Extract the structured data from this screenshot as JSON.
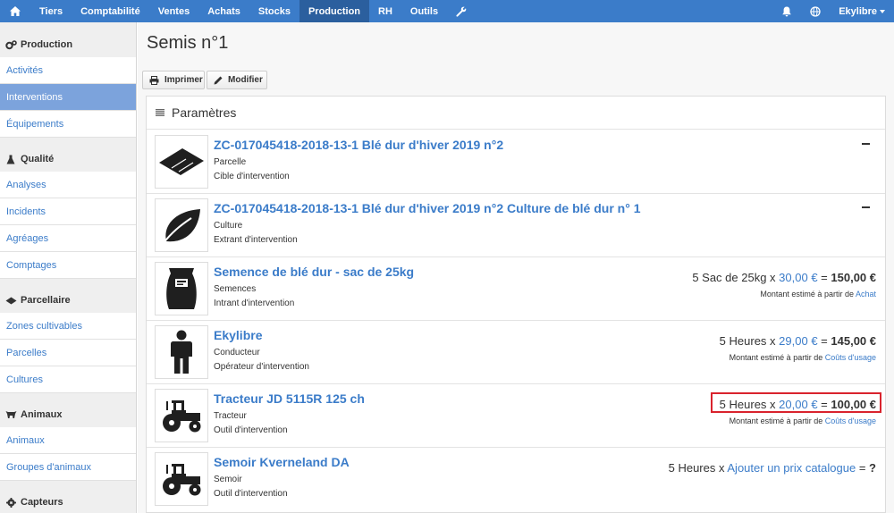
{
  "nav": {
    "items": [
      "Tiers",
      "Comptabilité",
      "Ventes",
      "Achats",
      "Stocks",
      "Production",
      "RH",
      "Outils"
    ],
    "active": "Production",
    "user": "Ekylibre",
    "accent": "#3b7cc9"
  },
  "sidebar": {
    "sections": [
      {
        "title": "Production",
        "icon": "gears-icon",
        "items": [
          "Activités",
          "Interventions",
          "Équipements"
        ]
      },
      {
        "title": "Qualité",
        "icon": "flask-icon",
        "items": [
          "Analyses",
          "Incidents",
          "Agréages",
          "Comptages"
        ]
      },
      {
        "title": "Parcellaire",
        "icon": "parcel-icon",
        "items": [
          "Zones cultivables",
          "Parcelles",
          "Cultures"
        ]
      },
      {
        "title": "Animaux",
        "icon": "cow-icon",
        "items": [
          "Animaux",
          "Groupes d'animaux"
        ]
      },
      {
        "title": "Capteurs",
        "icon": "gear-icon",
        "items": []
      }
    ],
    "active_item": "Interventions"
  },
  "page": {
    "title": "Semis n°1",
    "print_label": "Imprimer",
    "edit_label": "Modifier",
    "panel_title": "Paramètres"
  },
  "rows": [
    {
      "title": "ZC-017045418-2018-13-1 Blé dur d'hiver 2019 n°2",
      "sub1": "Parcelle",
      "sub2": "Cible d'intervention",
      "icon": "parcel-icon",
      "collapsed": true
    },
    {
      "title": "ZC-017045418-2018-13-1 Blé dur d'hiver 2019 n°2 Culture de blé dur n° 1",
      "sub1": "Culture",
      "sub2": "Extrant d'intervention",
      "icon": "leaf-icon",
      "collapsed": true
    },
    {
      "title": "Semence de blé dur - sac de 25kg",
      "sub1": "Semences",
      "sub2": "Intrant d'intervention",
      "icon": "seed-bag-icon",
      "calc": {
        "qty": "5 Sac de 25kg x",
        "price": "30,00 €",
        "eq": "=",
        "total": "150,00 €"
      },
      "est": {
        "prefix": "Montant estimé à partir de",
        "source": "Achat"
      }
    },
    {
      "title": "Ekylibre",
      "sub1": "Conducteur",
      "sub2": "Opérateur d'intervention",
      "icon": "person-icon",
      "calc": {
        "qty": "5 Heures x",
        "price": "29,00 €",
        "eq": "=",
        "total": "145,00 €"
      },
      "est": {
        "prefix": "Montant estimé à partir de",
        "source": "Coûts d'usage"
      }
    },
    {
      "title": "Tracteur JD 5115R 125 ch",
      "sub1": "Tracteur",
      "sub2": "Outil d'intervention",
      "icon": "tractor-icon",
      "calc": {
        "qty": "5 Heures x",
        "price": "20,00 €",
        "eq": "=",
        "total": "100,00 €"
      },
      "est": {
        "prefix": "Montant estimé à partir de",
        "source": "Coûts d'usage"
      },
      "highlighted": true
    },
    {
      "title": "Semoir Kverneland DA",
      "sub1": "Semoir",
      "sub2": "Outil d'intervention",
      "icon": "tractor-icon",
      "calc": {
        "qty": "5 Heures x",
        "price": "Ajouter un prix catalogue",
        "eq": "=",
        "total": "?"
      }
    }
  ]
}
